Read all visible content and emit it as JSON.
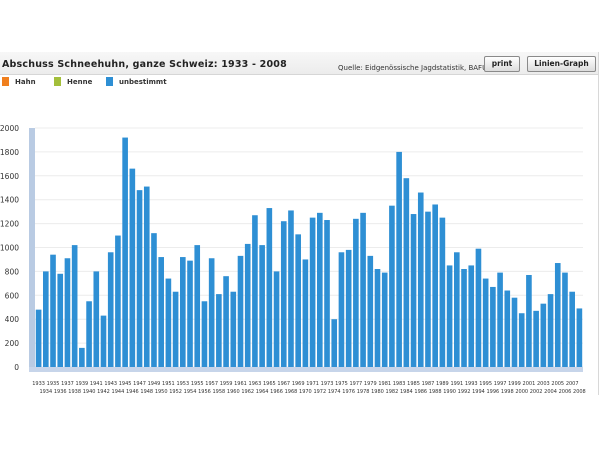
{
  "header": {
    "title": "Abschuss Schneehuhn, ganze Schweiz: 1933 - 2008",
    "source": "Quelle: Eidgenössische Jagdstatistik, BAFU",
    "print_label": "print",
    "line_graph_label": "Linien-Graph"
  },
  "legend": [
    {
      "label": "Hahn",
      "color": "#f07f1e"
    },
    {
      "label": "Henne",
      "color": "#a3bf3b"
    },
    {
      "label": "unbestimmt",
      "color": "#2e8fd4"
    }
  ],
  "chart_data": {
    "type": "bar",
    "title": "Abschuss Schneehuhn, ganze Schweiz: 1933 - 2008",
    "xlabel": "",
    "ylabel": "",
    "ylim": [
      0,
      2000
    ],
    "yticks": [
      "0",
      "200",
      "400",
      "600",
      "800",
      "1000",
      "1200",
      "1400",
      "1600",
      "1800",
      "2000"
    ],
    "grid": true,
    "legend_position": "top-left",
    "tick_labels_row1": [
      "1933",
      "1935",
      "1937",
      "1939",
      "1941",
      "1943",
      "1945",
      "1947",
      "1949",
      "1951",
      "1953",
      "1955",
      "1957",
      "1959",
      "1961",
      "1963",
      "1965",
      "1967",
      "1969",
      "1971",
      "1973",
      "1975",
      "1977",
      "1979",
      "1981",
      "1983",
      "1985",
      "1987",
      "1989",
      "1991",
      "1993",
      "1995",
      "1997",
      "1999",
      "2001",
      "2003",
      "2005",
      "2007"
    ],
    "tick_labels_row2": [
      "1934",
      "1936",
      "1938",
      "1940",
      "1942",
      "1944",
      "1946",
      "1948",
      "1950",
      "1952",
      "1954",
      "1956",
      "1958",
      "1960",
      "1962",
      "1964",
      "1966",
      "1968",
      "1970",
      "1972",
      "1974",
      "1976",
      "1978",
      "1980",
      "1982",
      "1984",
      "1986",
      "1988",
      "1990",
      "1992",
      "1994",
      "1996",
      "1998",
      "2000",
      "2002",
      "2004",
      "2006",
      "2008"
    ],
    "categories": [
      "1933",
      "1934",
      "1935",
      "1936",
      "1937",
      "1938",
      "1939",
      "1940",
      "1941",
      "1942",
      "1943",
      "1944",
      "1945",
      "1946",
      "1947",
      "1948",
      "1949",
      "1950",
      "1951",
      "1952",
      "1953",
      "1954",
      "1955",
      "1956",
      "1957",
      "1958",
      "1959",
      "1960",
      "1961",
      "1962",
      "1963",
      "1964",
      "1965",
      "1966",
      "1967",
      "1968",
      "1969",
      "1970",
      "1971",
      "1972",
      "1973",
      "1974",
      "1975",
      "1976",
      "1977",
      "1978",
      "1979",
      "1980",
      "1981",
      "1982",
      "1983",
      "1984",
      "1985",
      "1986",
      "1987",
      "1988",
      "1989",
      "1990",
      "1991",
      "1992",
      "1993",
      "1994",
      "1995",
      "1996",
      "1997",
      "1998",
      "1999",
      "2000",
      "2001",
      "2002",
      "2003",
      "2004",
      "2005",
      "2006",
      "2007",
      "2008"
    ],
    "series": [
      {
        "name": "Hahn",
        "color": "#f07f1e",
        "values": [
          0,
          0,
          0,
          0,
          0,
          0,
          0,
          0,
          0,
          0,
          0,
          0,
          0,
          0,
          0,
          0,
          0,
          0,
          0,
          0,
          0,
          0,
          0,
          0,
          0,
          0,
          0,
          0,
          0,
          0,
          0,
          0,
          0,
          0,
          0,
          0,
          0,
          0,
          0,
          0,
          0,
          0,
          0,
          0,
          0,
          0,
          0,
          0,
          0,
          0,
          0,
          0,
          0,
          0,
          0,
          0,
          0,
          0,
          0,
          0,
          0,
          0,
          0,
          0,
          0,
          0,
          0,
          0,
          0,
          0,
          0,
          0,
          0,
          0,
          0,
          0
        ]
      },
      {
        "name": "Henne",
        "color": "#a3bf3b",
        "values": [
          0,
          0,
          0,
          0,
          0,
          0,
          0,
          0,
          0,
          0,
          0,
          0,
          0,
          0,
          0,
          0,
          0,
          0,
          0,
          0,
          0,
          0,
          0,
          0,
          0,
          0,
          0,
          0,
          0,
          0,
          0,
          0,
          0,
          0,
          0,
          0,
          0,
          0,
          0,
          0,
          0,
          0,
          0,
          0,
          0,
          0,
          0,
          0,
          0,
          0,
          0,
          0,
          0,
          0,
          0,
          0,
          0,
          0,
          0,
          0,
          0,
          0,
          0,
          0,
          0,
          0,
          0,
          0,
          0,
          0,
          0,
          0,
          0,
          0,
          0,
          0
        ]
      },
      {
        "name": "unbestimmt",
        "color": "#2e8fd4",
        "values": [
          480,
          800,
          940,
          780,
          910,
          1020,
          160,
          550,
          800,
          430,
          960,
          1100,
          1920,
          1660,
          1480,
          1510,
          1120,
          920,
          740,
          630,
          920,
          890,
          1020,
          550,
          910,
          610,
          760,
          630,
          930,
          1030,
          1270,
          1020,
          1330,
          800,
          1220,
          1310,
          1110,
          900,
          1250,
          1290,
          1230,
          400,
          960,
          980,
          1240,
          1290,
          930,
          820,
          790,
          1350,
          1800,
          1580,
          1280,
          1460,
          1300,
          1360,
          1250,
          850,
          960,
          820,
          850,
          990,
          740,
          670,
          790,
          640,
          580,
          450,
          770,
          470,
          530,
          610,
          870,
          790,
          630,
          490
        ]
      }
    ]
  }
}
